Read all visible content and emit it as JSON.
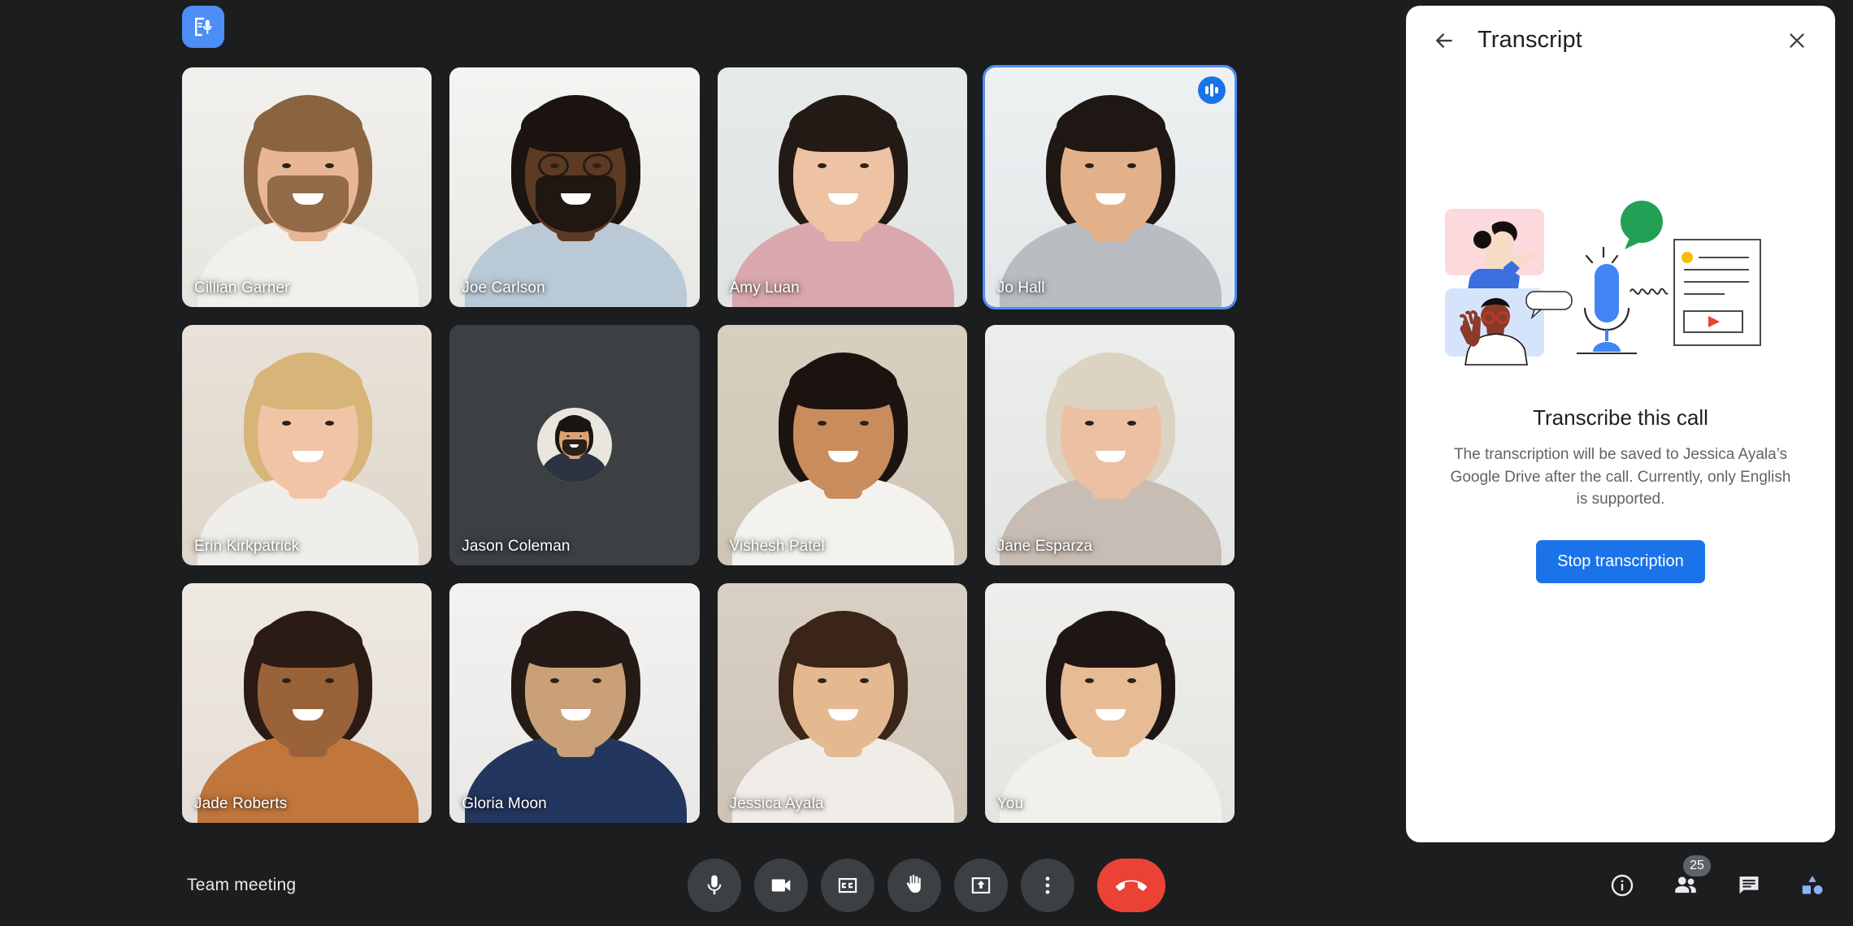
{
  "meeting": {
    "title": "Team meeting",
    "recording_badge_icon": "transcription-icon"
  },
  "grid": {
    "tiles": [
      {
        "name": "Cillian Garner",
        "camera_on": true,
        "speaking": false,
        "skin": "#e8b694",
        "hair": "#8a6440",
        "shirt": "#f1f0ec",
        "bg_top": "#f2f1ed",
        "bg_bottom": "#e6e4df",
        "beard": true,
        "glasses": false
      },
      {
        "name": "Joe Carlson",
        "camera_on": true,
        "speaking": false,
        "skin": "#5c3a24",
        "hair": "#1b1411",
        "shirt": "#b9c9d6",
        "bg_top": "#f4f4f2",
        "bg_bottom": "#e9e8e4",
        "beard": true,
        "glasses": true
      },
      {
        "name": "Amy Luan",
        "camera_on": true,
        "speaking": false,
        "skin": "#edc3a3",
        "hair": "#241a15",
        "shirt": "#d9a8ae",
        "bg_top": "#e6ebe9",
        "bg_bottom": "#dfe4e2",
        "beard": false,
        "glasses": false
      },
      {
        "name": "Jo Hall",
        "camera_on": true,
        "speaking": true,
        "skin": "#e3b189",
        "hair": "#1f1713",
        "shirt": "#b9bcc0",
        "bg_top": "#eef1f2",
        "bg_bottom": "#e3e7e8",
        "beard": false,
        "glasses": false
      },
      {
        "name": "Erin Kirkpatrick",
        "camera_on": true,
        "speaking": false,
        "skin": "#f0c4a4",
        "hair": "#d7b478",
        "shirt": "#f0eeea",
        "bg_top": "#e9e2d8",
        "bg_bottom": "#ded6ca",
        "beard": false,
        "glasses": false
      },
      {
        "name": "Jason Coleman",
        "camera_on": false,
        "speaking": false,
        "skin": "#d8a274",
        "hair": "#1a1512",
        "shirt": "#2b3340",
        "bg_top": "#3c4043",
        "bg_bottom": "#3c4043",
        "beard": true,
        "glasses": false
      },
      {
        "name": "Vishesh Patel",
        "camera_on": true,
        "speaking": false,
        "skin": "#c98c5c",
        "hair": "#1c1310",
        "shirt": "#f3f2ef",
        "bg_top": "#d8cfc0",
        "bg_bottom": "#cfc6b6",
        "beard": false,
        "glasses": false
      },
      {
        "name": "Jane Esparza",
        "camera_on": true,
        "speaking": false,
        "skin": "#ecc0a2",
        "hair": "#ddd3c2",
        "shirt": "#c7bdb5",
        "bg_top": "#eceeec",
        "bg_bottom": "#e2e5e3",
        "beard": false,
        "glasses": false
      },
      {
        "name": "Jade Roberts",
        "camera_on": true,
        "speaking": false,
        "skin": "#9a6239",
        "hair": "#2a1b14",
        "shirt": "#c1763c",
        "bg_top": "#efe9e3",
        "bg_bottom": "#e5ded7",
        "beard": false,
        "glasses": false
      },
      {
        "name": "Gloria Moon",
        "camera_on": true,
        "speaking": false,
        "skin": "#caa078",
        "hair": "#251b16",
        "shirt": "#23365e",
        "bg_top": "#f3f2f0",
        "bg_bottom": "#eae8e6",
        "beard": false,
        "glasses": false
      },
      {
        "name": "Jessica Ayala",
        "camera_on": true,
        "speaking": false,
        "skin": "#e5b98f",
        "hair": "#3b2519",
        "shirt": "#f0ece7",
        "bg_top": "#d9cfc4",
        "bg_bottom": "#cfc4b8",
        "beard": false,
        "glasses": false
      },
      {
        "name": "You",
        "camera_on": true,
        "speaking": false,
        "skin": "#e7bb93",
        "hair": "#1e1614",
        "shirt": "#f2f0ec",
        "bg_top": "#eeeeec",
        "bg_bottom": "#e4e4e1",
        "beard": false,
        "glasses": false
      }
    ]
  },
  "controls": {
    "center": [
      {
        "name": "microphone",
        "icon": "mic-icon",
        "label": "Turn off microphone"
      },
      {
        "name": "camera",
        "icon": "camera-icon",
        "label": "Turn off camera"
      },
      {
        "name": "captions",
        "icon": "cc-icon",
        "label": "Turn on captions"
      },
      {
        "name": "raise-hand",
        "icon": "hand-icon",
        "label": "Raise hand"
      },
      {
        "name": "present",
        "icon": "present-screen-icon",
        "label": "Present now"
      },
      {
        "name": "more-options",
        "icon": "more-vertical-icon",
        "label": "More options"
      }
    ],
    "hangup": {
      "icon": "call-end-icon",
      "label": "Leave call",
      "color": "#ea4335"
    },
    "right": [
      {
        "name": "meeting-details",
        "icon": "info-icon",
        "label": "Meeting details",
        "badge": ""
      },
      {
        "name": "participants",
        "icon": "people-icon",
        "label": "Show everyone",
        "badge": "25"
      },
      {
        "name": "chat",
        "icon": "chat-icon",
        "label": "Chat with everyone",
        "badge": ""
      },
      {
        "name": "activities",
        "icon": "activities-icon",
        "label": "Activities",
        "badge": ""
      }
    ]
  },
  "transcript_panel": {
    "title": "Transcript",
    "back_icon": "arrow-back-icon",
    "close_icon": "close-icon",
    "heading": "Transcribe this call",
    "description": "The transcription will be saved to Jessica Ayala’s Google Drive after the call. Currently, only English is supported.",
    "button_label": "Stop transcription",
    "button_color": "#1a73e8",
    "illustration": "transcription-illustration"
  }
}
